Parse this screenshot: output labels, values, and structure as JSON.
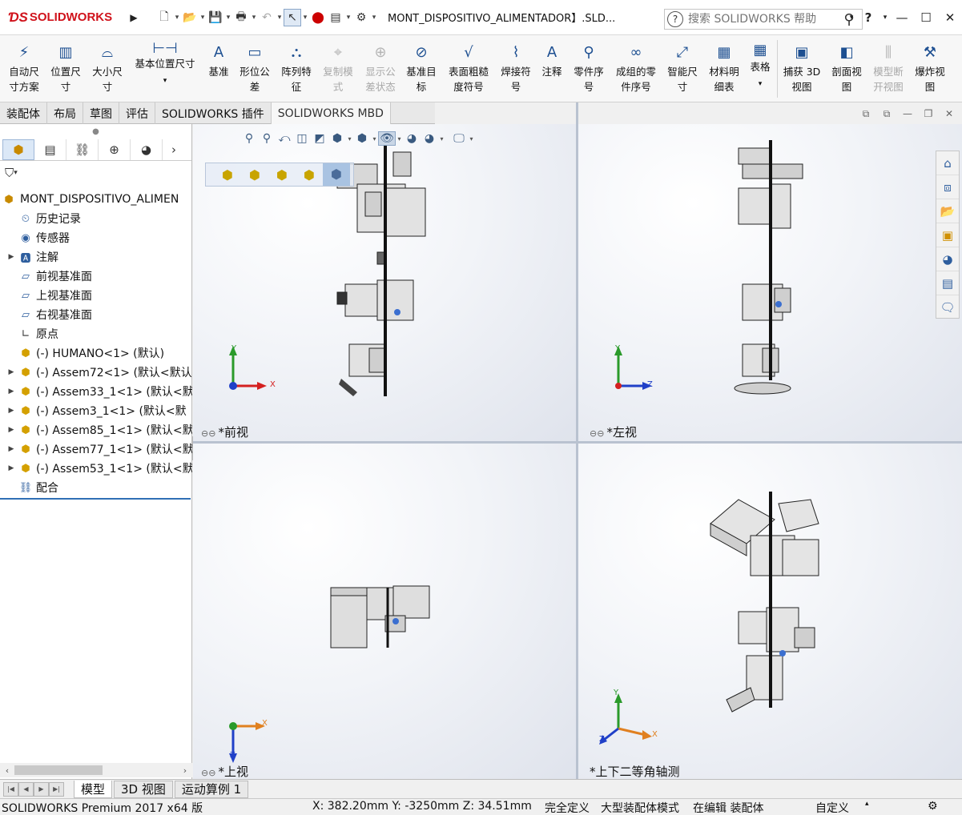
{
  "app": {
    "brand": "SOLIDWORKS",
    "document_title": "MONT_DISPOSITIVO_ALIMENTADOR】.SLD...",
    "search_placeholder": "搜索 SOLIDWORKS 帮助"
  },
  "ribbon": {
    "buttons": [
      {
        "label1": "自动尺",
        "label2": "寸方案",
        "icon": "auto-dimension-icon",
        "disabled": false
      },
      {
        "label1": "位置尺",
        "label2": "寸",
        "icon": "location-dimension-icon",
        "disabled": false
      },
      {
        "label1": "大小尺",
        "label2": "寸",
        "icon": "size-dimension-icon",
        "disabled": false
      },
      {
        "label1": "基本位置尺寸",
        "label2": "",
        "icon": "basic-location-dimension-icon",
        "disabled": false
      },
      {
        "label1": "基准",
        "label2": "",
        "icon": "datum-icon",
        "disabled": false
      },
      {
        "label1": "形位公",
        "label2": "差",
        "icon": "geometric-tolerance-icon",
        "disabled": false
      },
      {
        "label1": "阵列特",
        "label2": "征",
        "icon": "pattern-feature-icon",
        "disabled": false
      },
      {
        "label1": "复制模",
        "label2": "式",
        "icon": "copy-scheme-icon",
        "disabled": true
      },
      {
        "label1": "显示公",
        "label2": "差状态",
        "icon": "show-tolerance-status-icon",
        "disabled": true
      },
      {
        "label1": "基准目",
        "label2": "标",
        "icon": "datum-target-icon",
        "disabled": false
      },
      {
        "label1": "表面粗糙",
        "label2": "度符号",
        "icon": "surface-finish-icon",
        "disabled": false
      },
      {
        "label1": "焊接符",
        "label2": "号",
        "icon": "weld-symbol-icon",
        "disabled": false
      },
      {
        "label1": "注释",
        "label2": "",
        "icon": "note-icon",
        "disabled": false
      },
      {
        "label1": "零件序",
        "label2": "号",
        "icon": "balloon-icon",
        "disabled": false
      },
      {
        "label1": "成组的零",
        "label2": "件序号",
        "icon": "stacked-balloon-icon",
        "disabled": false
      },
      {
        "label1": "智能尺",
        "label2": "寸",
        "icon": "smart-dimension-icon",
        "disabled": false
      },
      {
        "label1": "材料明",
        "label2": "细表",
        "icon": "bom-icon",
        "disabled": false
      },
      {
        "label1": "表格",
        "label2": "",
        "icon": "table-icon",
        "disabled": false
      },
      {
        "label1": "捕获 3D",
        "label2": "视图",
        "icon": "capture-3d-view-icon",
        "disabled": false
      },
      {
        "label1": "剖面视",
        "label2": "图",
        "icon": "section-view-icon",
        "disabled": false
      },
      {
        "label1": "模型断",
        "label2": "开视图",
        "icon": "model-break-view-icon",
        "disabled": true
      },
      {
        "label1": "爆炸视",
        "label2": "图",
        "icon": "exploded-view-icon",
        "disabled": false
      }
    ]
  },
  "tabs": [
    {
      "label": "装配体",
      "active": false
    },
    {
      "label": "布局",
      "active": false
    },
    {
      "label": "草图",
      "active": false
    },
    {
      "label": "评估",
      "active": false
    },
    {
      "label": "SOLIDWORKS 插件",
      "active": false
    },
    {
      "label": "SOLIDWORKS MBD",
      "active": true
    }
  ],
  "tree": {
    "root": "MONT_DISPOSITIVO_ALIMEN",
    "items": [
      {
        "label": "历史记录",
        "expandable": false
      },
      {
        "label": "传感器",
        "expandable": false
      },
      {
        "label": "注解",
        "expandable": true
      },
      {
        "label": "前视基准面",
        "expandable": false
      },
      {
        "label": "上视基准面",
        "expandable": false
      },
      {
        "label": "右视基准面",
        "expandable": false
      },
      {
        "label": "原点",
        "expandable": false
      },
      {
        "label": "(-) HUMANO<1> (默认)",
        "expandable": false
      },
      {
        "label": "(-) Assem72<1> (默认<默认",
        "expandable": true
      },
      {
        "label": "(-) Assem33_1<1> (默认<默",
        "expandable": true
      },
      {
        "label": "(-) Assem3_1<1> (默认<默",
        "expandable": true
      },
      {
        "label": "(-) Assem85_1<1> (默认<默",
        "expandable": true
      },
      {
        "label": "(-) Assem77_1<1> (默认<默",
        "expandable": true
      },
      {
        "label": "(-) Assem53_1<1> (默认<默",
        "expandable": true
      },
      {
        "label": "配合",
        "expandable": false
      }
    ]
  },
  "viewports": [
    {
      "label": "*前视",
      "axis_h": "X",
      "axis_v": "Y"
    },
    {
      "label": "*左视",
      "axis_h": "Z",
      "axis_v": "Y"
    },
    {
      "label": "*上视",
      "axis_h": "X",
      "axis_v": "Z"
    },
    {
      "label": "*上下二等角轴测",
      "axis_h": "X",
      "axis_v": "Y",
      "axis_d": "Z"
    }
  ],
  "bottom_tabs": [
    {
      "label": "模型",
      "active": true
    },
    {
      "label": "3D 视图",
      "active": false
    },
    {
      "label": "运动算例 1",
      "active": false
    }
  ],
  "status": {
    "product": "SOLIDWORKS Premium 2017 x64 版",
    "coords": "X: 382.20mm Y: -3250mm Z: 34.51mm",
    "definition": "完全定义",
    "mode": "大型装配体模式",
    "editing": "在编辑 装配体",
    "units": "自定义"
  },
  "colors": {
    "brand": "#d0121b",
    "accent": "#2f6fb5",
    "axis_x": "#d42020",
    "axis_y": "#2a9a2a",
    "axis_z": "#2040c8"
  }
}
